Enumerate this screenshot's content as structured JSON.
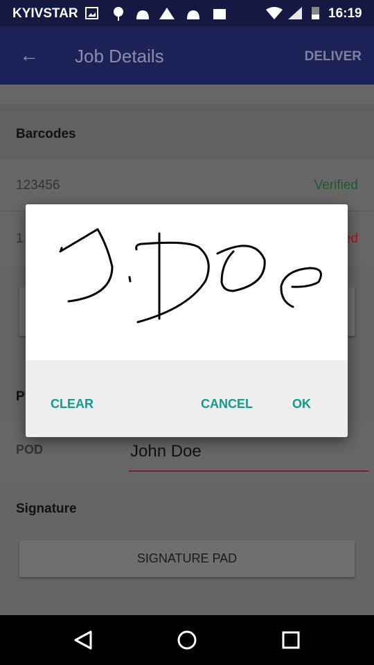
{
  "status_bar": {
    "carrier": "KYIVSTAR",
    "time": "16:19",
    "icons": [
      "image-icon",
      "android-debug-icon",
      "android-icon",
      "warning-icon",
      "android-icon",
      "play-store-icon",
      "wifi-icon",
      "signal-icon",
      "battery-icon"
    ]
  },
  "app_bar": {
    "title": "Job Details",
    "back_icon": "arrow-left-icon",
    "action": "DELIVER"
  },
  "barcodes": {
    "header": "Barcodes",
    "rows": [
      {
        "code": "123456",
        "status": "Verified",
        "status_color": "#1e5a2a"
      },
      {
        "code": "1",
        "status": "ed",
        "status_color": "#b01010"
      }
    ]
  },
  "pod_section": {
    "header": "P",
    "label": "POD",
    "value": "John Doe",
    "underline_color": "#7a1f3a"
  },
  "signature": {
    "header": "Signature",
    "button": "SIGNATURE PAD"
  },
  "dialog": {
    "clear": "CLEAR",
    "cancel": "CANCEL",
    "ok": "OK",
    "accent": "#139a8c"
  },
  "nav_bar": {
    "icons": [
      "back-triangle-icon",
      "home-circle-icon",
      "recents-square-icon"
    ]
  }
}
